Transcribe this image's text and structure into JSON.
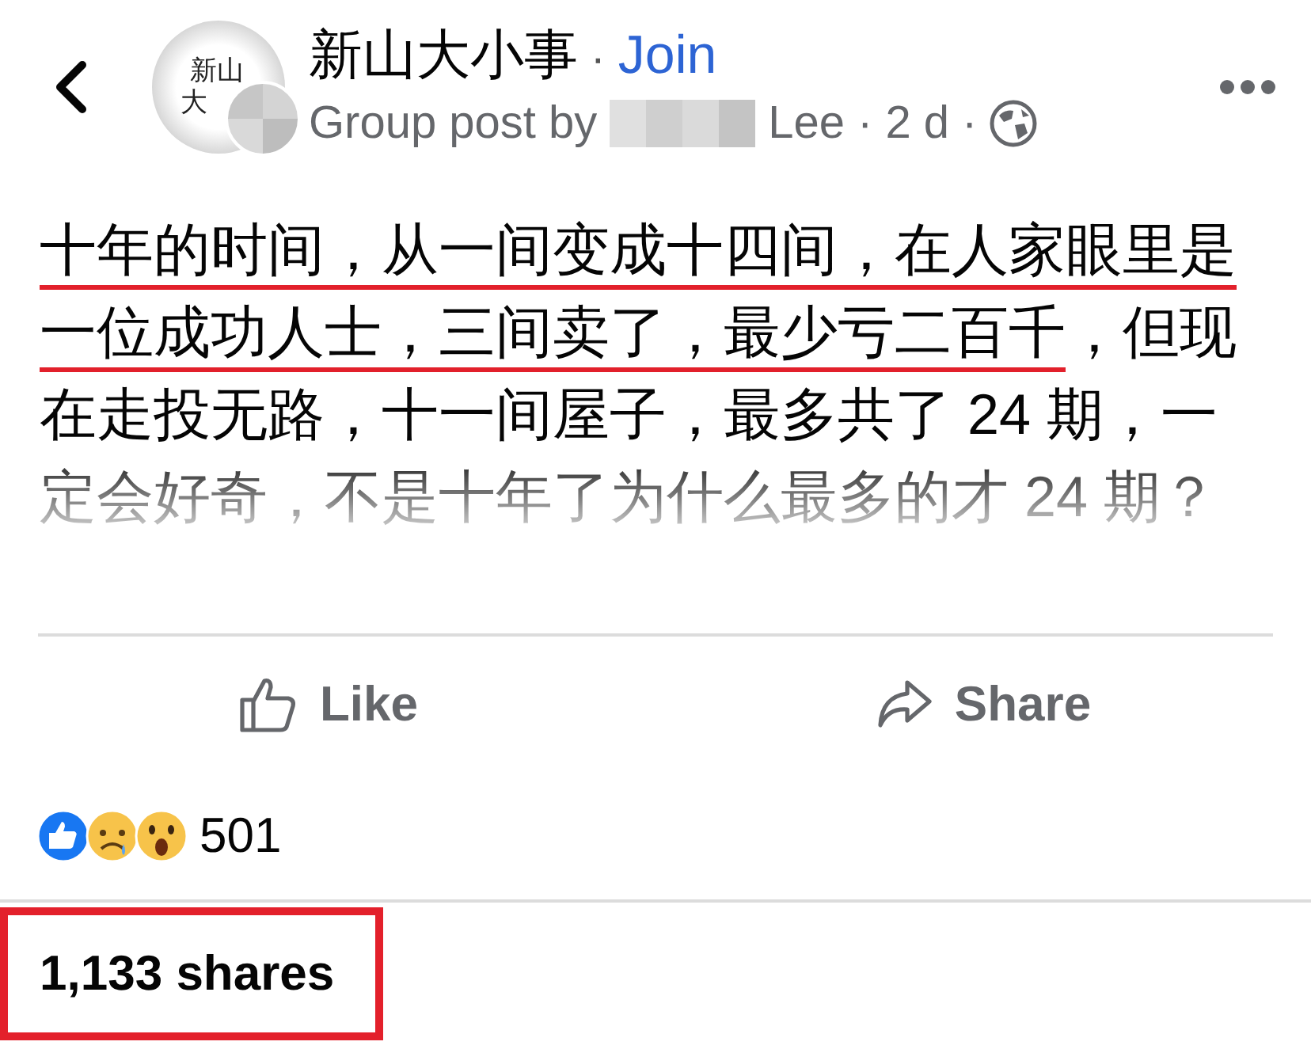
{
  "group": {
    "avatar_lines": [
      "新山",
      "大"
    ],
    "name": "新山大小事",
    "separator": "·",
    "join_label": "Join"
  },
  "byline": {
    "prefix": "Group post by",
    "author": "Lee",
    "separator_1": "·",
    "time": "2 d",
    "separator_2": "·"
  },
  "post": {
    "highlighted": "十年的时间，从一间变成十四间，在人家眼里是一位成功人士，三间卖了，最少亏二百千",
    "rest": "，但现在走投无路，十一间屋子，最多共了 24 期，一定会好奇，不是十年了为什么最多的才 24 期？"
  },
  "actions": [
    {
      "kind": "like",
      "label": "Like"
    },
    {
      "kind": "share",
      "label": "Share"
    }
  ],
  "reactions": {
    "icons": [
      {
        "kind": "like"
      },
      {
        "kind": "sad"
      },
      {
        "kind": "wow"
      }
    ],
    "count": "501"
  },
  "shares": "1,133 shares"
}
